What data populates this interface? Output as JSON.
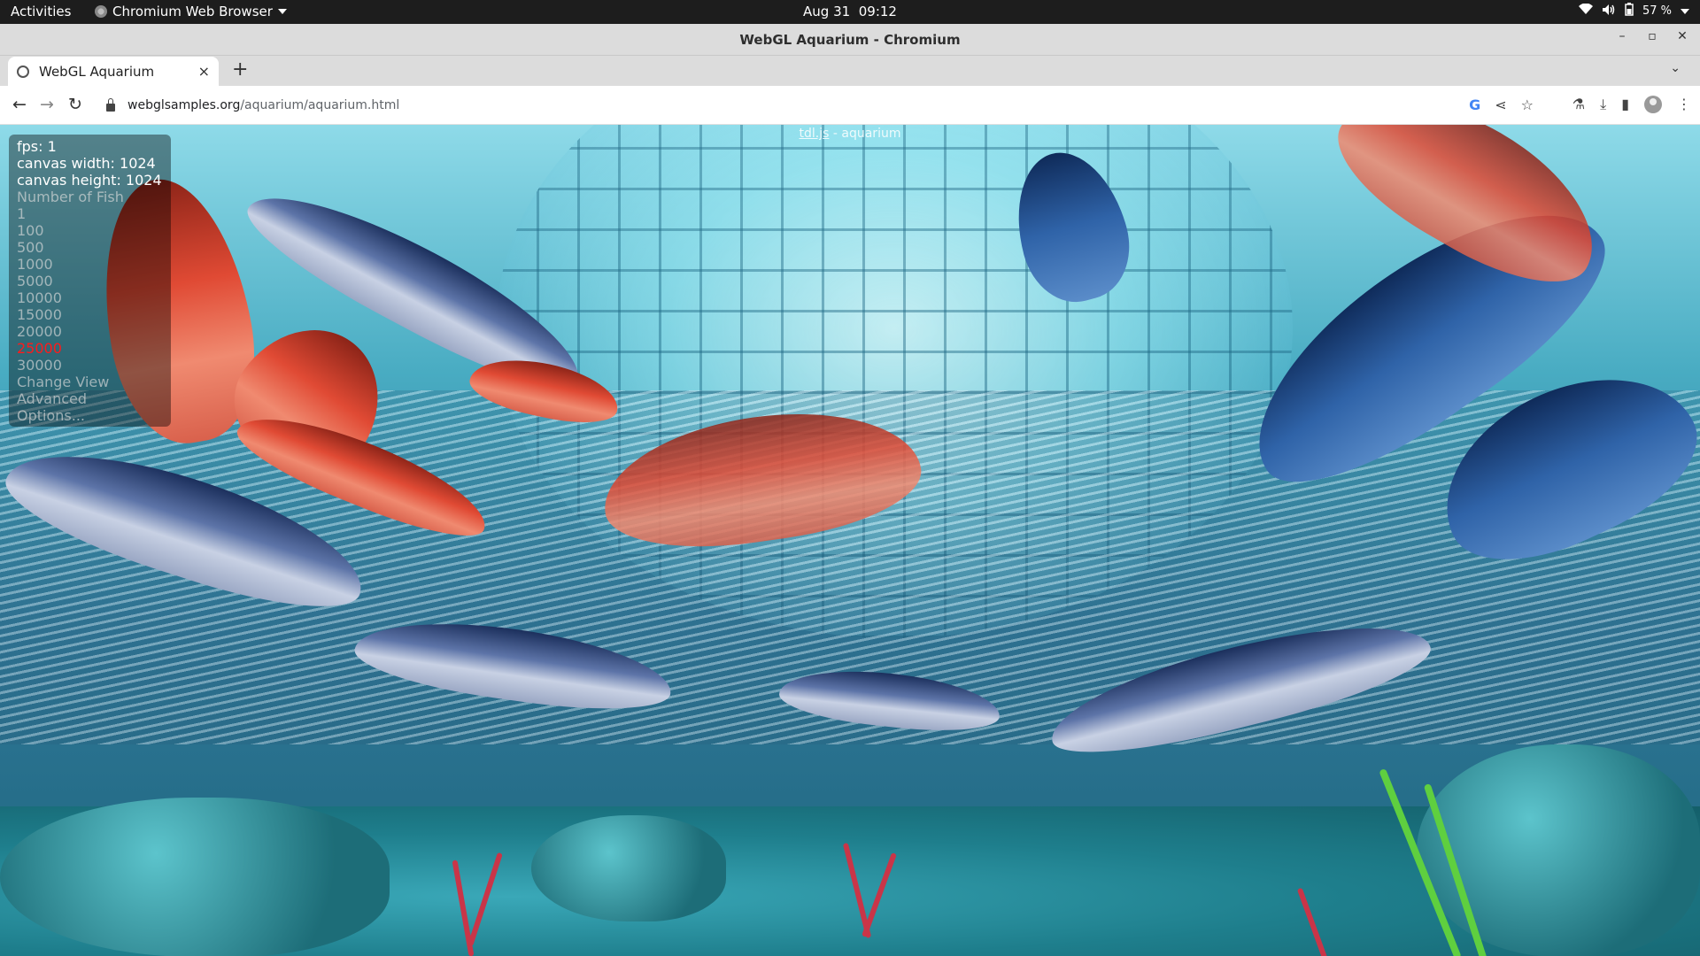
{
  "topbar": {
    "activities": "Activities",
    "app_name": "Chromium Web Browser",
    "date": "Aug 31",
    "time": "09:12",
    "battery": "57 %"
  },
  "window": {
    "title": "WebGL Aquarium - Chromium"
  },
  "tabs": [
    {
      "title": "WebGL Aquarium",
      "close": "×"
    }
  ],
  "toolbar": {
    "url_domain": "webglsamples.org",
    "url_path": "/aquarium/aquarium.html"
  },
  "page": {
    "header_link": "tdl.js",
    "header_text": " - aquarium",
    "stats": {
      "fps": "fps: 1",
      "canvas_width": "canvas width: 1024",
      "canvas_height": "canvas height: 1024"
    },
    "fish_menu": {
      "heading": "Number of Fish",
      "options": [
        "1",
        "100",
        "500",
        "1000",
        "5000",
        "10000",
        "15000",
        "20000",
        "25000",
        "30000"
      ],
      "selected": "25000"
    },
    "menu_links": {
      "change_view": "Change View",
      "advanced": "Advanced",
      "options": "Options..."
    }
  },
  "colors": {
    "selected_option": "#ff1a1a",
    "water": "#50bed7"
  }
}
